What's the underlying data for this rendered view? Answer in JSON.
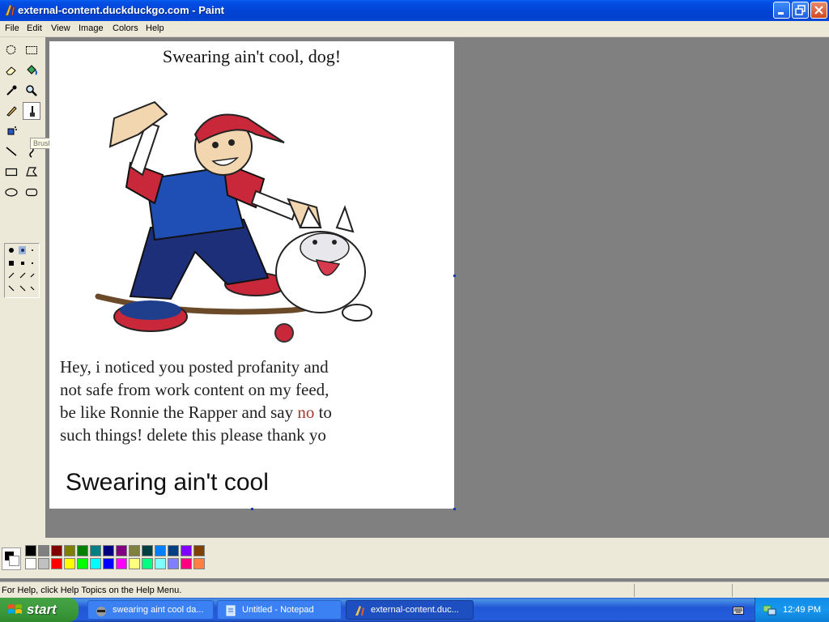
{
  "window": {
    "title": "external-content.duckduckgo.com - Paint"
  },
  "menu": [
    "File",
    "Edit",
    "View",
    "Image",
    "Colors",
    "Help"
  ],
  "toolbox": {
    "tooltip": "Brush",
    "tools": [
      "free-form-select",
      "select",
      "eraser",
      "fill-with-color",
      "pick-color",
      "magnifier",
      "pencil",
      "brush",
      "airbrush",
      "text",
      "line",
      "curve",
      "rectangle",
      "polygon",
      "ellipse",
      "rounded-rectangle"
    ],
    "active_tool": "brush"
  },
  "canvas": {
    "heading": "Swearing ain't cool, dog!",
    "body_lines": [
      "Hey, i noticed you posted profanity and",
      "not safe from work content on my feed,",
      "be like Ronnie the Rapper and say ",
      "no",
      " to",
      "such things! delete this please thank yo"
    ],
    "footer": "Swearing ain't cool"
  },
  "palette": {
    "foreground": "#000000",
    "background": "#ffffff",
    "row1": [
      "#000000",
      "#808080",
      "#800000",
      "#808000",
      "#008000",
      "#008080",
      "#000080",
      "#800080",
      "#808040",
      "#004040",
      "#0080ff",
      "#004080",
      "#8000ff",
      "#804000"
    ],
    "row2": [
      "#ffffff",
      "#c0c0c0",
      "#ff0000",
      "#ffff00",
      "#00ff00",
      "#00ffff",
      "#0000ff",
      "#ff00ff",
      "#ffff80",
      "#00ff80",
      "#80ffff",
      "#8080ff",
      "#ff0080",
      "#ff8040"
    ]
  },
  "status": {
    "text": "For Help, click Help Topics on the Help Menu."
  },
  "taskbar": {
    "start_label": "start",
    "tasks": [
      {
        "label": "swearing aint cool da...",
        "active": false
      },
      {
        "label": "Untitled - Notepad",
        "active": false
      },
      {
        "label": "external-content.duc...",
        "active": true
      }
    ],
    "clock": "12:49 PM"
  }
}
